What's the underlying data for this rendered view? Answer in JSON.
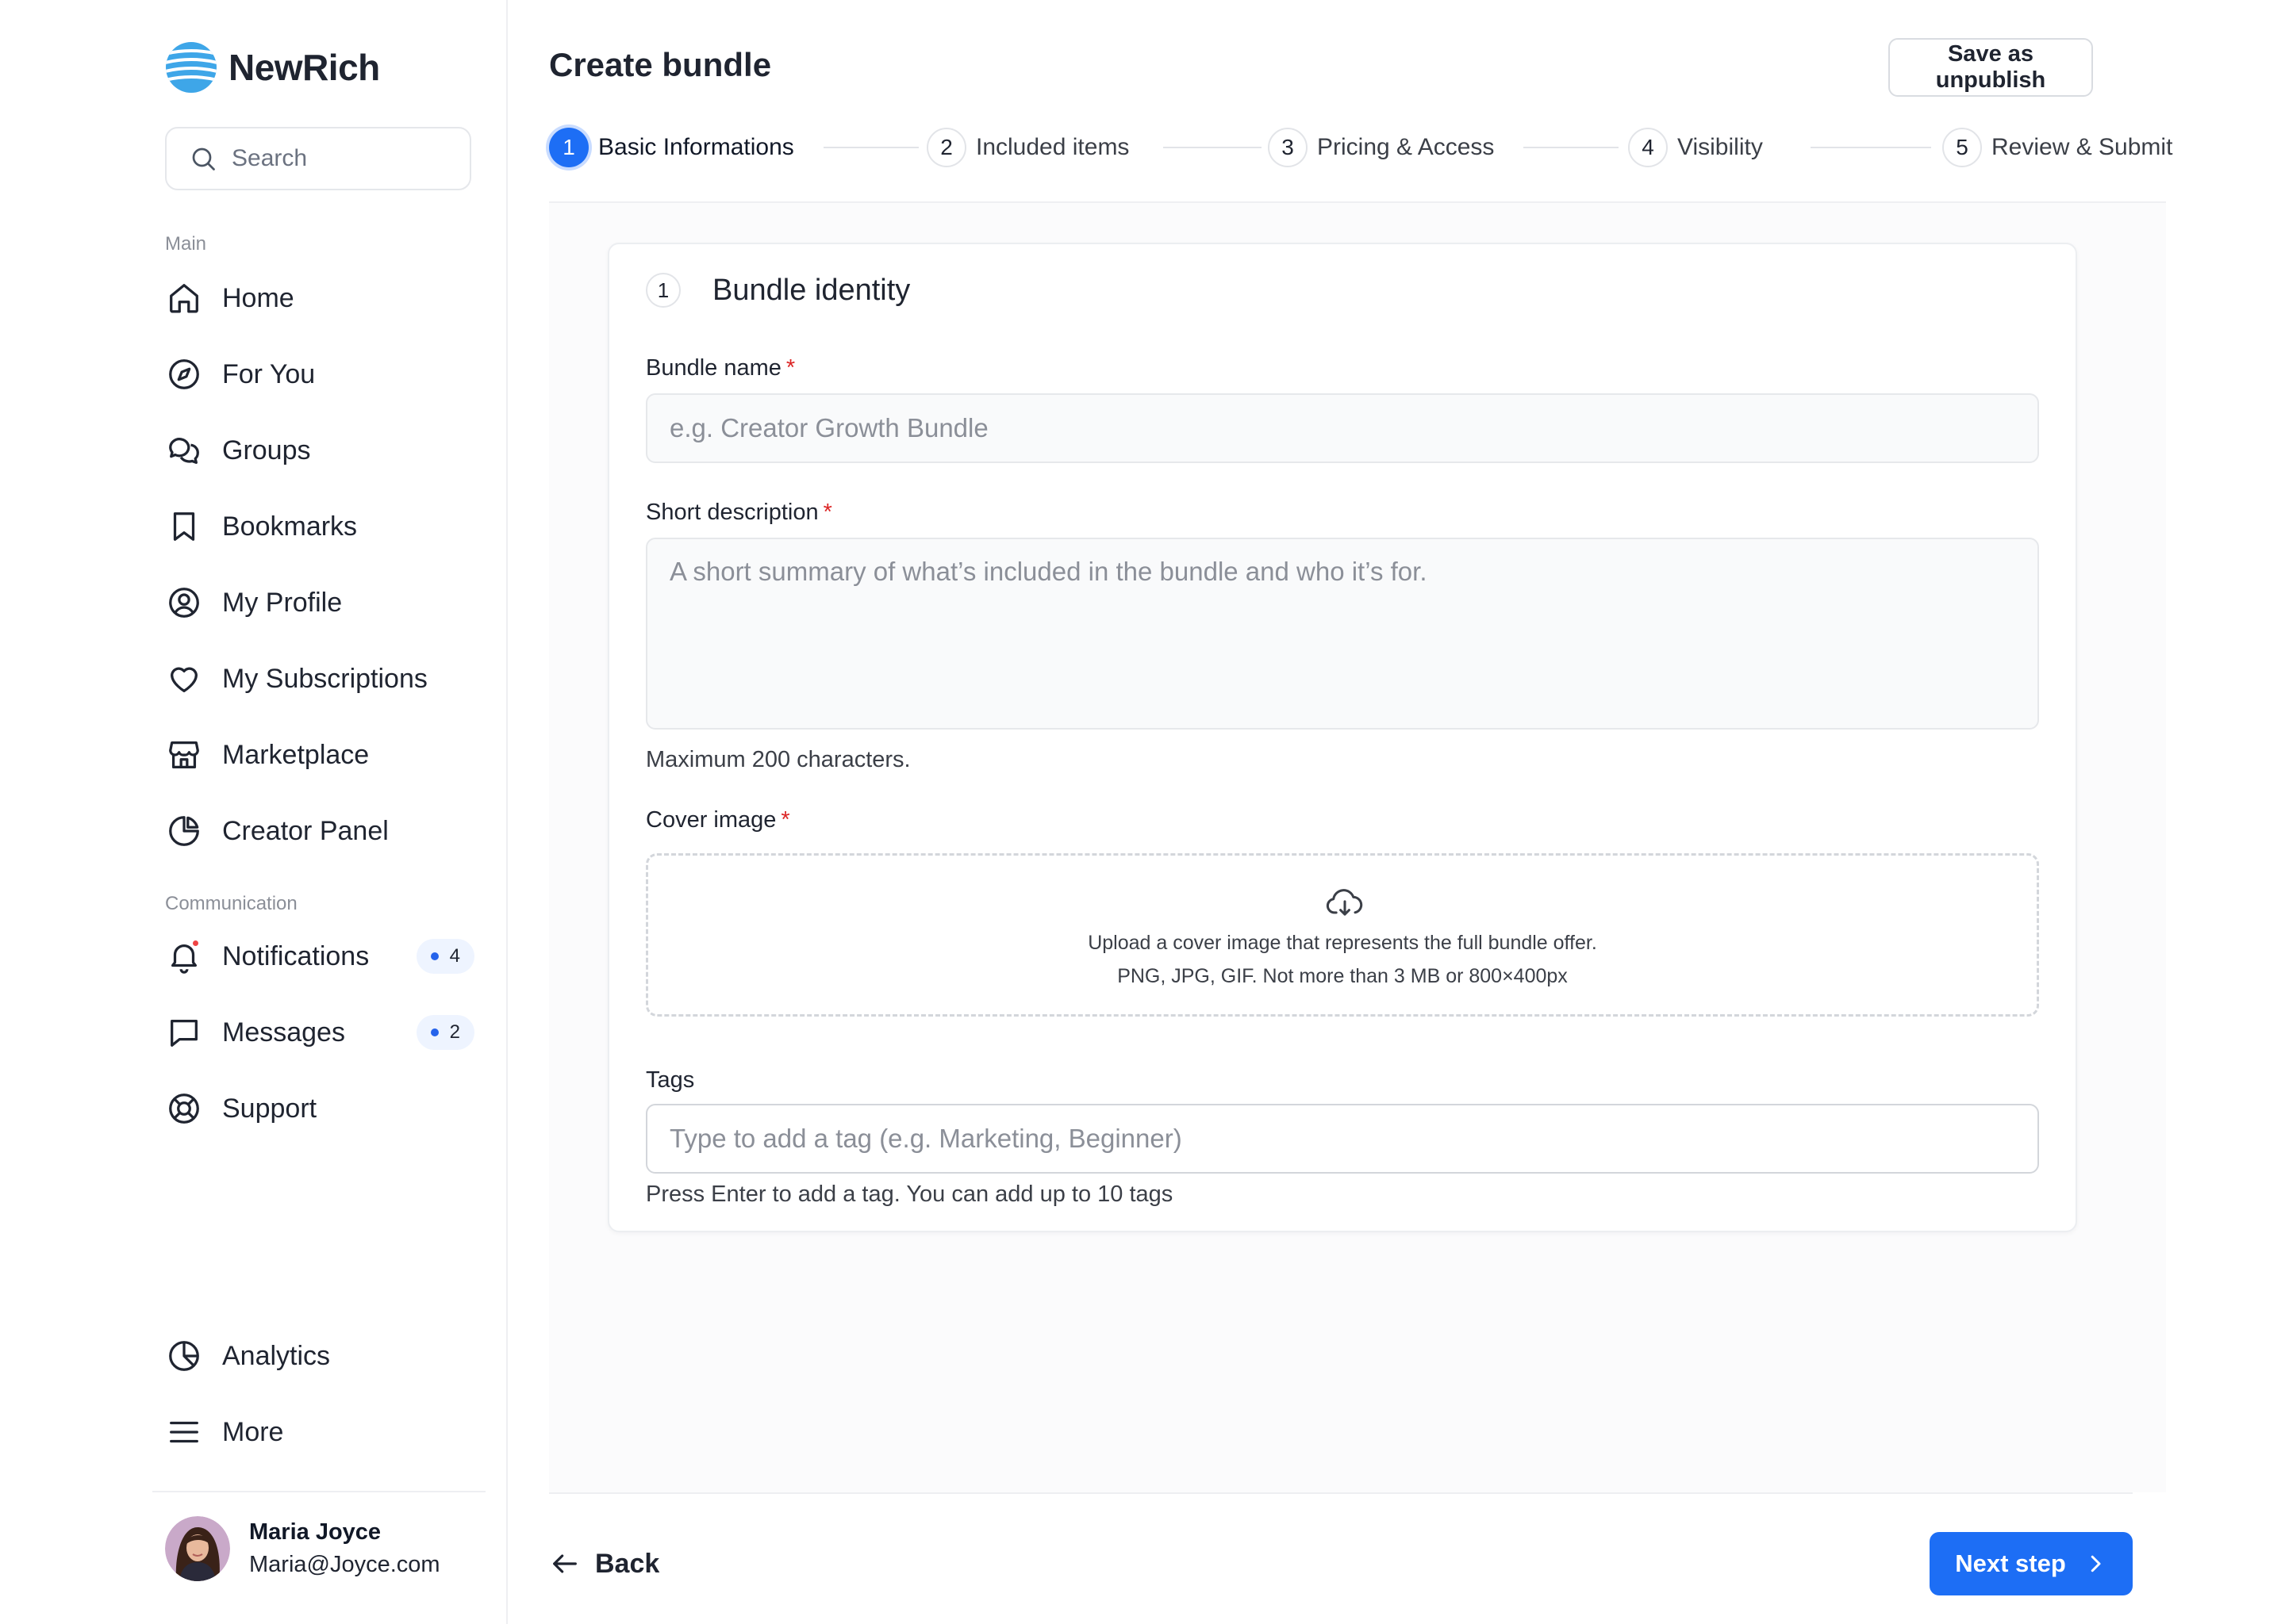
{
  "app": {
    "name": "NewRich"
  },
  "search": {
    "placeholder": "Search"
  },
  "sidebar": {
    "main_label": "Main",
    "main_items": [
      {
        "label": "Home",
        "icon": "home-icon"
      },
      {
        "label": "For You",
        "icon": "compass-icon"
      },
      {
        "label": "Groups",
        "icon": "chat-bubbles-icon"
      },
      {
        "label": "Bookmarks",
        "icon": "bookmark-icon"
      },
      {
        "label": "My Profile",
        "icon": "user-circle-icon"
      },
      {
        "label": "My Subscriptions",
        "icon": "heart-icon"
      },
      {
        "label": "Marketplace",
        "icon": "storefront-icon"
      },
      {
        "label": "Creator Panel",
        "icon": "pie-chart-icon"
      }
    ],
    "communication_label": "Communication",
    "communication_items": [
      {
        "label": "Notifications",
        "icon": "bell-icon",
        "badge": "4"
      },
      {
        "label": "Messages",
        "icon": "message-icon",
        "badge": "2"
      },
      {
        "label": "Support",
        "icon": "lifebuoy-icon"
      }
    ],
    "bottom_items": [
      {
        "label": "Analytics",
        "icon": "analytics-icon"
      },
      {
        "label": "More",
        "icon": "menu-icon"
      }
    ]
  },
  "user": {
    "name": "Maria Joyce",
    "email": "Maria@Joyce.com"
  },
  "header": {
    "title": "Create bundle",
    "unpublish_label": "Save as unpublish"
  },
  "steps": [
    {
      "num": "1",
      "label": "Basic Informations",
      "active": true
    },
    {
      "num": "2",
      "label": "Included items"
    },
    {
      "num": "3",
      "label": "Pricing & Access"
    },
    {
      "num": "4",
      "label": "Visibility"
    },
    {
      "num": "5",
      "label": "Review & Submit"
    }
  ],
  "card": {
    "num": "1",
    "title": "Bundle identity",
    "required_mark": "*",
    "name_label": "Bundle name",
    "name_placeholder": "e.g. Creator Growth Bundle",
    "desc_label": "Short description",
    "desc_placeholder": "A short summary of what’s included in the bundle and who it’s for.",
    "desc_hint": "Maximum 200 characters.",
    "cover_label": "Cover image",
    "cover_line1": "Upload a cover image that represents the full bundle offer.",
    "cover_line2": "PNG, JPG, GIF. Not more than 3 MB or 800×400px",
    "tags_label": "Tags",
    "tags_placeholder": "Type to add a tag (e.g. Marketing, Beginner)",
    "tags_hint": "Press Enter to add a tag. You can add up to 10 tags"
  },
  "footer": {
    "back_label": "Back",
    "next_label": "Next step"
  },
  "colors": {
    "accent": "#1d6ef5",
    "required": "#dc2626",
    "badge_bg": "#eef4ff",
    "notification_dot": "#ef4444"
  }
}
